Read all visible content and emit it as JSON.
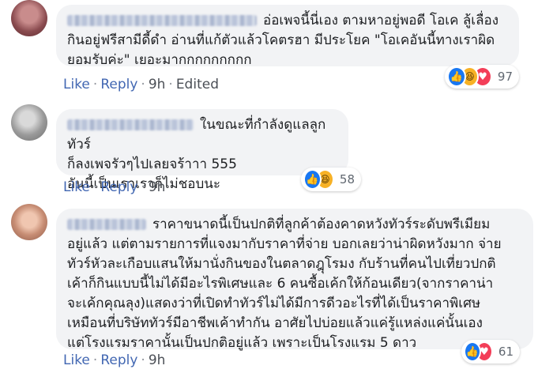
{
  "comments": [
    {
      "text": "อ่อเพจนี้นี่เอง ตามหาอยู่พอดี โอเค ลู้เลื่อง\nกินอยู่ฟรีสามีดี้ดำ อ่านที่แก้ตัวแล้วโคตรฮา มีประโยค \"โอเคอันนี้ทางเราผิด\nยอมรับค่ะ\" เยอะมากกกกกกกกก",
      "actions": {
        "like": "Like",
        "reply": "Reply",
        "time": "9h",
        "edited": "Edited"
      },
      "reactions": {
        "icons": [
          "like-icon",
          "haha-icon",
          "love-icon"
        ],
        "count": "97"
      }
    },
    {
      "text": "ในขณะที่กำลังดูแลลูกทัวร์\nก็ลงเพจรัวๆไปเลยจร้าาา 555\nอันนี้เป็นเราเราก็ไม่ชอบนะ",
      "actions": {
        "like": "Like",
        "reply": "Reply",
        "time": "9h"
      },
      "reactions": {
        "icons": [
          "like-icon",
          "haha-icon"
        ],
        "count": "58"
      }
    },
    {
      "text": "ราคาขนาดนี้เป็นปกติที่ลูกค้าต้องคาดหวังทัวร์ระดับพรีเมียม\nอยู่แล้ว แต่ตามรายการที่แจงมากับราคาที่จ่าย บอกเลยว่าน่าผิดหวังมาก จ่าย\nทัวร์หัวละเกือบแสนให้มานั่งกินของในตลาดฎุโรมง กับร้านที่คนไปเที่ยวปกติ\nเค้าก็กินแบบนี้ไม่ได้มีอะไรพิเศษและ 6 คนซื้อเค้กให้ก้อนเดียว(จากราคาน่า\nจะเค้กคุณลุง)แสดงว่าที่เปิดทำทัวร์ไม่ได้มีการดีวอะไรที่ได้เป็นราคาพิเศษ\nเหมือนที่บริษัททัวร์มีอาชีพเค้าทำกัน อาศัยไปบ่อยแล้วแค่รู้แหล่งแค่นั้นเอง\nแต่โรงแรมราคานั้นเป็นปกติอยู่แล้ว เพราะเป็นโรงแรม 5 ดาว",
      "actions": {
        "like": "Like",
        "reply": "Reply",
        "time": "9h"
      },
      "reactions": {
        "icons": [
          "like-icon",
          "love-icon"
        ],
        "count": "61"
      }
    }
  ]
}
